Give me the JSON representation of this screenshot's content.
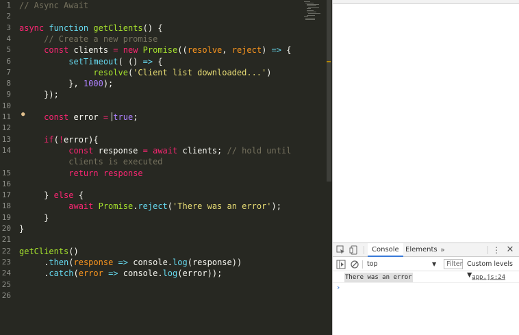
{
  "editor": {
    "lines": [
      {
        "n": "1",
        "tokens": [
          {
            "t": "// Async Await",
            "c": "comment"
          }
        ]
      },
      {
        "n": "2",
        "tokens": []
      },
      {
        "n": "3",
        "tokens": [
          {
            "t": "async",
            "c": "keyword"
          },
          {
            "t": " ",
            "c": "plain"
          },
          {
            "t": "function",
            "c": "storage"
          },
          {
            "t": " ",
            "c": "plain"
          },
          {
            "t": "getClients",
            "c": "func"
          },
          {
            "t": "() {",
            "c": "plain"
          }
        ]
      },
      {
        "n": "4",
        "tokens": [
          {
            "t": "     ",
            "c": "plain"
          },
          {
            "t": "// Create a new promise",
            "c": "comment"
          }
        ]
      },
      {
        "n": "5",
        "tokens": [
          {
            "t": "     ",
            "c": "plain"
          },
          {
            "t": "const",
            "c": "keyword"
          },
          {
            "t": " clients ",
            "c": "plain"
          },
          {
            "t": "=",
            "c": "keyword"
          },
          {
            "t": " ",
            "c": "plain"
          },
          {
            "t": "new",
            "c": "keyword"
          },
          {
            "t": " ",
            "c": "plain"
          },
          {
            "t": "Promise",
            "c": "func"
          },
          {
            "t": "((",
            "c": "plain"
          },
          {
            "t": "resolve",
            "c": "param"
          },
          {
            "t": ", ",
            "c": "plain"
          },
          {
            "t": "reject",
            "c": "param"
          },
          {
            "t": ") ",
            "c": "plain"
          },
          {
            "t": "=>",
            "c": "storage"
          },
          {
            "t": " {",
            "c": "plain"
          }
        ]
      },
      {
        "n": "6",
        "tokens": [
          {
            "t": "          ",
            "c": "plain"
          },
          {
            "t": "setTimeout",
            "c": "builtin"
          },
          {
            "t": "( () ",
            "c": "plain"
          },
          {
            "t": "=>",
            "c": "storage"
          },
          {
            "t": " {",
            "c": "plain"
          }
        ]
      },
      {
        "n": "7",
        "tokens": [
          {
            "t": "               ",
            "c": "plain"
          },
          {
            "t": "resolve",
            "c": "func"
          },
          {
            "t": "(",
            "c": "plain"
          },
          {
            "t": "'Client list downloaded...'",
            "c": "string"
          },
          {
            "t": ")",
            "c": "plain"
          }
        ]
      },
      {
        "n": "8",
        "tokens": [
          {
            "t": "          }, ",
            "c": "plain"
          },
          {
            "t": "1000",
            "c": "number"
          },
          {
            "t": ");",
            "c": "plain"
          }
        ]
      },
      {
        "n": "9",
        "tokens": [
          {
            "t": "     });",
            "c": "plain"
          }
        ]
      },
      {
        "n": "10",
        "tokens": []
      },
      {
        "n": "11",
        "tokens": [
          {
            "t": "     ",
            "c": "plain"
          },
          {
            "t": "const",
            "c": "keyword"
          },
          {
            "t": " error ",
            "c": "plain"
          },
          {
            "t": "=",
            "c": "keyword"
          },
          {
            "t": " ",
            "c": "plain"
          },
          {
            "t": "true",
            "c": "bool"
          },
          {
            "t": ";",
            "c": "plain"
          }
        ]
      },
      {
        "n": "12",
        "tokens": []
      },
      {
        "n": "13",
        "tokens": [
          {
            "t": "     ",
            "c": "plain"
          },
          {
            "t": "if",
            "c": "keyword"
          },
          {
            "t": "(",
            "c": "plain"
          },
          {
            "t": "!",
            "c": "keyword"
          },
          {
            "t": "error){",
            "c": "plain"
          }
        ]
      },
      {
        "n": "14",
        "tokens": [
          {
            "t": "          ",
            "c": "plain"
          },
          {
            "t": "const",
            "c": "keyword"
          },
          {
            "t": " response ",
            "c": "plain"
          },
          {
            "t": "=",
            "c": "keyword"
          },
          {
            "t": " ",
            "c": "plain"
          },
          {
            "t": "await",
            "c": "keyword"
          },
          {
            "t": " clients; ",
            "c": "plain"
          },
          {
            "t": "// hold until",
            "c": "comment"
          }
        ]
      },
      {
        "n": "",
        "tokens": [
          {
            "t": "          ",
            "c": "plain"
          },
          {
            "t": "clients is executed",
            "c": "comment"
          }
        ]
      },
      {
        "n": "",
        "tokens": [
          {
            "t": "          ",
            "c": "plain"
          },
          {
            "t": "return",
            "c": "keyword"
          },
          {
            "t": " ",
            "c": "plain"
          },
          {
            "t": "response",
            "c": "keyword"
          }
        ]
      },
      {
        "n": "15",
        "tokens": []
      },
      {
        "n": "16",
        "tokens": [
          {
            "t": "     } ",
            "c": "plain"
          },
          {
            "t": "else",
            "c": "keyword"
          },
          {
            "t": " {",
            "c": "plain"
          }
        ]
      },
      {
        "n": "17",
        "tokens": [
          {
            "t": "          ",
            "c": "plain"
          },
          {
            "t": "await",
            "c": "keyword"
          },
          {
            "t": " ",
            "c": "plain"
          },
          {
            "t": "Promise",
            "c": "func"
          },
          {
            "t": ".",
            "c": "plain"
          },
          {
            "t": "reject",
            "c": "builtin"
          },
          {
            "t": "(",
            "c": "plain"
          },
          {
            "t": "'There was an error'",
            "c": "string"
          },
          {
            "t": ");",
            "c": "plain"
          }
        ]
      },
      {
        "n": "18",
        "tokens": [
          {
            "t": "     }",
            "c": "plain"
          }
        ]
      },
      {
        "n": "19",
        "tokens": [
          {
            "t": "}",
            "c": "plain"
          }
        ]
      },
      {
        "n": "20",
        "tokens": []
      },
      {
        "n": "21",
        "tokens": [
          {
            "t": "getClients",
            "c": "func"
          },
          {
            "t": "()",
            "c": "plain"
          }
        ]
      },
      {
        "n": "22",
        "tokens": [
          {
            "t": "     .",
            "c": "plain"
          },
          {
            "t": "then",
            "c": "builtin"
          },
          {
            "t": "(",
            "c": "plain"
          },
          {
            "t": "response",
            "c": "param"
          },
          {
            "t": " ",
            "c": "plain"
          },
          {
            "t": "=>",
            "c": "storage"
          },
          {
            "t": " ",
            "c": "plain"
          },
          {
            "t": "console",
            "c": "plain"
          },
          {
            "t": ".",
            "c": "plain"
          },
          {
            "t": "log",
            "c": "builtin"
          },
          {
            "t": "(response))",
            "c": "plain"
          }
        ]
      },
      {
        "n": "23",
        "tokens": [
          {
            "t": "     .",
            "c": "plain"
          },
          {
            "t": "catch",
            "c": "builtin"
          },
          {
            "t": "(",
            "c": "plain"
          },
          {
            "t": "error",
            "c": "param"
          },
          {
            "t": " ",
            "c": "plain"
          },
          {
            "t": "=>",
            "c": "storage"
          },
          {
            "t": " ",
            "c": "plain"
          },
          {
            "t": "console",
            "c": "plain"
          },
          {
            "t": ".",
            "c": "plain"
          },
          {
            "t": "log",
            "c": "builtin"
          },
          {
            "t": "(error));",
            "c": "plain"
          }
        ]
      },
      {
        "n": "24",
        "tokens": []
      },
      {
        "n": "25",
        "tokens": []
      }
    ],
    "gutter_numbers": [
      "1",
      "2",
      "3",
      "4",
      "5",
      "6",
      "7",
      "8",
      "9",
      "10",
      "11",
      "12",
      "13",
      "14",
      "",
      "15",
      "16",
      "17",
      "18",
      "19",
      "20",
      "21",
      "22",
      "23",
      "24",
      "25",
      "26"
    ]
  },
  "devtools": {
    "tabs": [
      {
        "label": "Console",
        "active": true
      },
      {
        "label": "Elements",
        "active": false
      }
    ],
    "more_label": "»",
    "context": "top",
    "filter_placeholder": "Filter",
    "levels_label": "Custom levels ▼",
    "message": {
      "text": "There was an error",
      "source": "app.js:24"
    },
    "prompt": "›"
  },
  "colors": {
    "editor_bg": "#272822",
    "comment": "#75715e",
    "keyword": "#f92672",
    "function": "#a6e22e",
    "string": "#e6db74",
    "number": "#ae81ff",
    "param": "#fd971f",
    "devtools_accent": "#3879d9"
  }
}
